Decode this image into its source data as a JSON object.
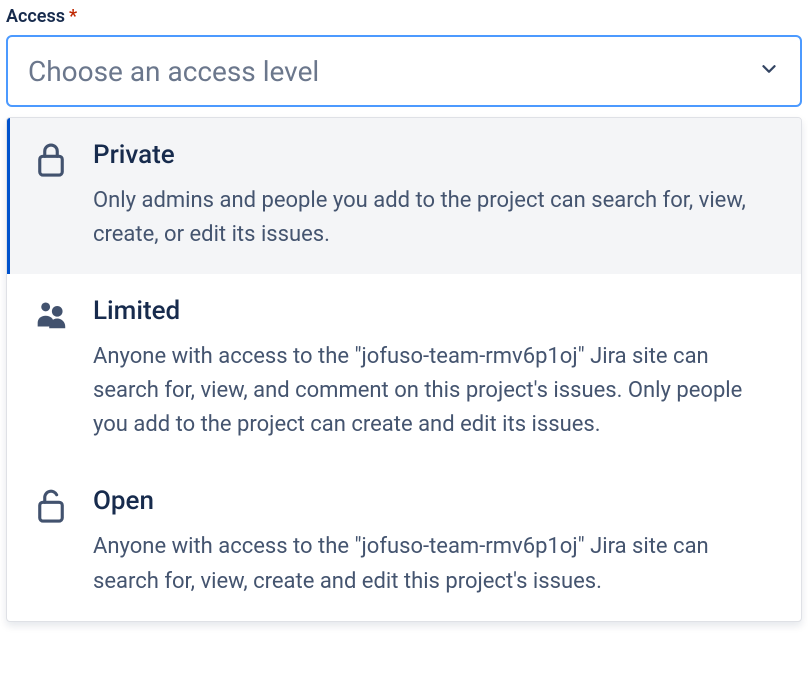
{
  "field": {
    "label": "Access",
    "required_marker": "*",
    "placeholder": "Choose an access level"
  },
  "options": [
    {
      "icon": "lock-closed",
      "title": "Private",
      "description": "Only admins and people you add to the project can search for, view, create, or edit its issues.",
      "selected": true
    },
    {
      "icon": "people",
      "title": "Limited",
      "description": "Anyone with access to the \"jofuso-team-rmv6p1oj\" Jira site can search for, view, and comment on this project's issues. Only people you add to the project can create and edit its issues.",
      "selected": false
    },
    {
      "icon": "lock-open",
      "title": "Open",
      "description": "Anyone with access to the \"jofuso-team-rmv6p1oj\" Jira site can search for, view, create and edit this project's issues.",
      "selected": false
    }
  ]
}
